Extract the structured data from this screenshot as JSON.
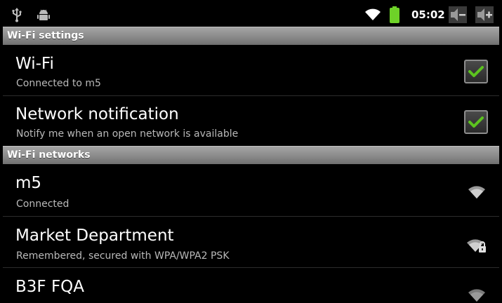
{
  "status_bar": {
    "time": "05:02",
    "icons": [
      "usb-icon",
      "android-debug-icon",
      "wifi-signal-icon",
      "battery-icon",
      "volume-down-icon",
      "volume-up-icon"
    ],
    "battery_color": "#6ed228"
  },
  "wifi_settings": {
    "header": "Wi-Fi settings",
    "wifi": {
      "title": "Wi-Fi",
      "summary": "Connected to m5",
      "checked": true
    },
    "network_notification": {
      "title": "Network notification",
      "summary": "Notify me when an open network is available",
      "checked": true
    }
  },
  "wifi_networks": {
    "header": "Wi-Fi networks",
    "items": [
      {
        "title": "m5",
        "summary": "Connected",
        "secured": false
      },
      {
        "title": "Market Department",
        "summary": "Remembered, secured with WPA/WPA2 PSK",
        "secured": true
      },
      {
        "title": "B3F FQA",
        "summary": "",
        "secured": false
      }
    ]
  },
  "colors": {
    "check_green": "#5cc31f",
    "header_gray": "#8a8a8a",
    "summary_gray": "#b9b9b9"
  }
}
